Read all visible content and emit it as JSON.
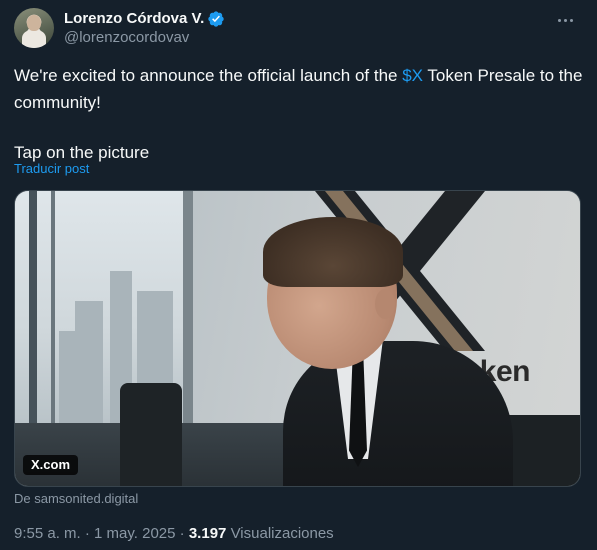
{
  "author": {
    "display_name": "Lorenzo Córdova V.",
    "handle": "@lorenzocordovav",
    "verified": true
  },
  "tweet": {
    "text_before": "We're excited to announce the official launch of the ",
    "cashtag": "$X",
    "text_after": " Token Presale to the community!",
    "text_para2": "Tap on the picture",
    "translate_label": "Traducir post"
  },
  "media": {
    "domain_badge": "X.com",
    "image_text": "X Token",
    "source_label": "De samsonited.digital"
  },
  "meta": {
    "time": "9:55 a. m.",
    "separator": "·",
    "date": "1 may. 2025",
    "views_count": "3.197",
    "views_label": "Visualizaciones"
  },
  "colors": {
    "background": "#15202b",
    "accent": "#1d9bf0",
    "secondary_text": "#8b98a5",
    "primary_text": "#f7f9f9"
  }
}
